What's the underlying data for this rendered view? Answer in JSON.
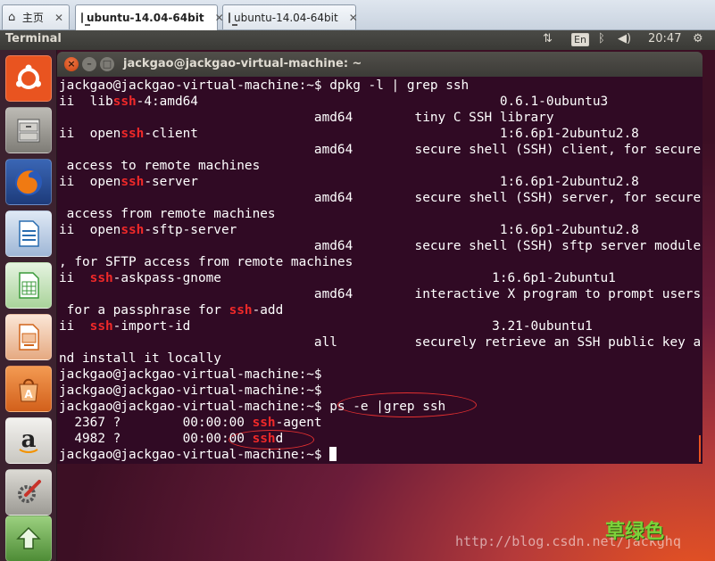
{
  "host": {
    "tabs": [
      {
        "label": "主页",
        "icon": "home-icon",
        "active": false
      },
      {
        "label": "ubuntu-14.04-64bit",
        "icon": "vm-icon",
        "active": true
      },
      {
        "label": "ubuntu-14.04-64bit",
        "icon": "vm-icon",
        "active": false
      }
    ],
    "close_glyph": "✕"
  },
  "panel": {
    "app_title": "Terminal",
    "keyboard": "En",
    "clock": "20:47",
    "icons": [
      "network-icon",
      "keyboard-layout-icon",
      "bluetooth-icon",
      "volume-icon",
      "settings-icon"
    ]
  },
  "launcher": {
    "items": [
      {
        "name": "dash-home",
        "icon": "ubuntu-logo-icon",
        "color": "#e95420"
      },
      {
        "name": "files",
        "icon": "file-cabinet-icon",
        "color": "#8a8a86"
      },
      {
        "name": "firefox",
        "icon": "firefox-icon",
        "color": "#e66000"
      },
      {
        "name": "writer",
        "icon": "libreoffice-writer-icon",
        "color": "#2a6db0"
      },
      {
        "name": "calc",
        "icon": "libreoffice-calc-icon",
        "color": "#3a9a3a"
      },
      {
        "name": "impress",
        "icon": "libreoffice-impress-icon",
        "color": "#d0641a"
      },
      {
        "name": "software-center",
        "icon": "shopping-bag-icon",
        "color": "#e8782a"
      },
      {
        "name": "amazon",
        "icon": "amazon-icon",
        "color": "#d8d6d0"
      },
      {
        "name": "system-settings",
        "icon": "wrench-gear-icon",
        "color": "#c8c6c0"
      },
      {
        "name": "software-updater",
        "icon": "updater-icon",
        "color": "#5aa040"
      }
    ]
  },
  "terminal": {
    "title": "jackgao@jackgao-virtual-machine: ~",
    "lines": [
      [
        {
          "t": "jackgao@jackgao-virtual-machine:~$ dpkg -l | grep ssh"
        }
      ],
      [
        {
          "t": "ii  lib"
        },
        {
          "t": "ssh",
          "hl": true
        },
        {
          "t": "-4:amd64                                       0.6.1-0ubuntu3"
        }
      ],
      [
        {
          "t": "                                 amd64        tiny C SSH library"
        }
      ],
      [
        {
          "t": "ii  open"
        },
        {
          "t": "ssh",
          "hl": true
        },
        {
          "t": "-client                                       1:6.6p1-2ubuntu2.8"
        }
      ],
      [
        {
          "t": "                                 amd64        secure shell (SSH) client, for secure"
        }
      ],
      [
        {
          "t": " access to remote machines"
        }
      ],
      [
        {
          "t": "ii  open"
        },
        {
          "t": "ssh",
          "hl": true
        },
        {
          "t": "-server                                       1:6.6p1-2ubuntu2.8"
        }
      ],
      [
        {
          "t": "                                 amd64        secure shell (SSH) server, for secure"
        }
      ],
      [
        {
          "t": " access from remote machines"
        }
      ],
      [
        {
          "t": "ii  open"
        },
        {
          "t": "ssh",
          "hl": true
        },
        {
          "t": "-sftp-server                                  1:6.6p1-2ubuntu2.8"
        }
      ],
      [
        {
          "t": "                                 amd64        secure shell (SSH) sftp server module"
        }
      ],
      [
        {
          "t": ", for SFTP access from remote machines"
        }
      ],
      [
        {
          "t": "ii  "
        },
        {
          "t": "ssh",
          "hl": true
        },
        {
          "t": "-askpass-gnome                                   1:6.6p1-2ubuntu1"
        }
      ],
      [
        {
          "t": "                                 amd64        interactive X program to prompt users"
        }
      ],
      [
        {
          "t": " for a passphrase for "
        },
        {
          "t": "ssh",
          "hl": true
        },
        {
          "t": "-add"
        }
      ],
      [
        {
          "t": "ii  "
        },
        {
          "t": "ssh",
          "hl": true
        },
        {
          "t": "-import-id                                       3.21-0ubuntu1"
        }
      ],
      [
        {
          "t": "                                 all          securely retrieve an SSH public key a"
        }
      ],
      [
        {
          "t": "nd install it locally"
        }
      ],
      [
        {
          "t": "jackgao@jackgao-virtual-machine:~$"
        }
      ],
      [
        {
          "t": "jackgao@jackgao-virtual-machine:~$"
        }
      ],
      [
        {
          "t": "jackgao@jackgao-virtual-machine:~$ ps -e |grep ssh"
        }
      ],
      [
        {
          "t": "  2367 ?        00:00:00 "
        },
        {
          "t": "ssh",
          "hl": true
        },
        {
          "t": "-agent"
        }
      ],
      [
        {
          "t": "  4982 ?        00:00:00 "
        },
        {
          "t": "ssh",
          "hl": true
        },
        {
          "t": "d"
        }
      ],
      [
        {
          "t": "jackgao@jackgao-virtual-machine:~$ "
        },
        {
          "cursor": true
        }
      ]
    ]
  },
  "watermark": {
    "url": "http://blog.csdn.net/jackghq",
    "cn": "草绿色"
  }
}
